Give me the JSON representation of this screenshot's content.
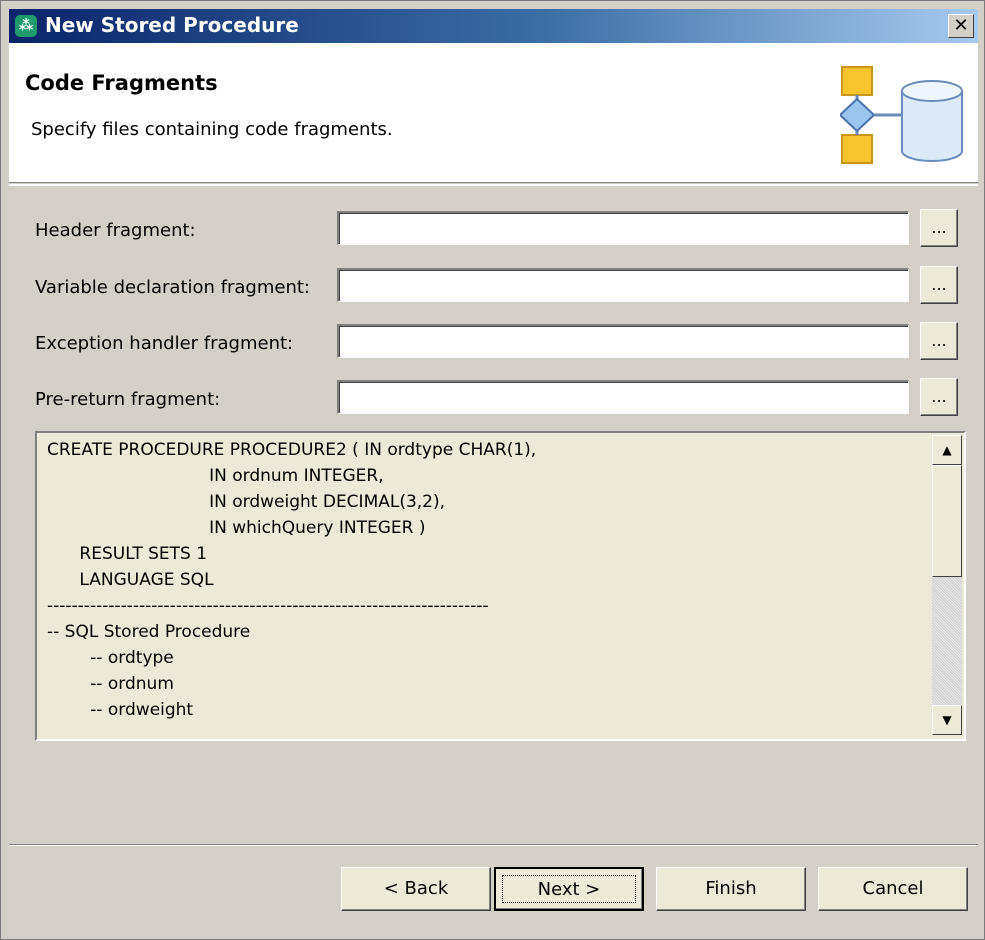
{
  "window": {
    "title": "New Stored Procedure",
    "close_glyph": "✕"
  },
  "header": {
    "title": "Code Fragments",
    "description": "Specify files containing code fragments."
  },
  "fields": [
    {
      "label": "Header fragment:",
      "value": "",
      "browse": "..."
    },
    {
      "label": "Variable declaration fragment:",
      "value": "",
      "browse": "..."
    },
    {
      "label": "Exception handler fragment:",
      "value": "",
      "browse": "..."
    },
    {
      "label": "Pre-return fragment:",
      "value": "",
      "browse": "..."
    }
  ],
  "code_preview": {
    "lines": [
      "CREATE PROCEDURE PROCEDURE2 ( IN ordtype CHAR(1),",
      "                              IN ordnum INTEGER,",
      "                              IN ordweight DECIMAL(3,2),",
      "                              IN whichQuery INTEGER )",
      "      RESULT SETS 1",
      "      LANGUAGE SQL",
      "------------------------------------------------------------------------",
      "-- SQL Stored Procedure",
      "        -- ordtype",
      "        -- ordnum",
      "        -- ordweight"
    ],
    "scroll_up_glyph": "▲",
    "scroll_down_glyph": "▼"
  },
  "buttons": {
    "back": "< Back",
    "next": "Next >",
    "finish": "Finish",
    "cancel": "Cancel"
  },
  "colors": {
    "titlebar_start": "#0a246a",
    "dialog_bg": "#d4d0c8"
  }
}
